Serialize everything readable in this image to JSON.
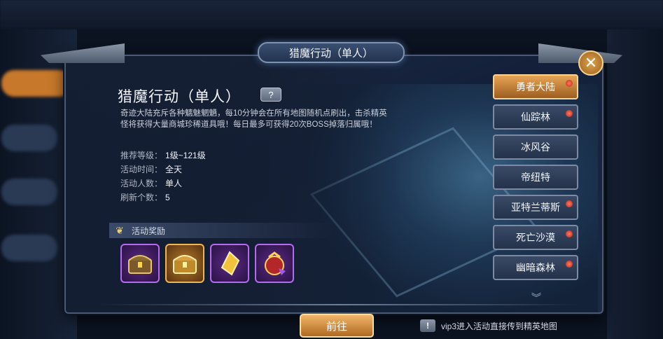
{
  "panel": {
    "header": "猎魔行动（单人）",
    "title": "猎魔行动（单人）",
    "help_glyph": "?",
    "close_glyph": "✕",
    "description_line1": "奇迹大陆充斥各种魑魅魍魉，每10分钟会在所有地图随机点刷出，击杀精英",
    "description_line2": "怪将获得大量商城珍稀道具哦！每日最多可获得20次BOSS掉落归属哦！"
  },
  "info": [
    {
      "label": "推荐等级：",
      "value": "1级~121级"
    },
    {
      "label": "活动时间：",
      "value": "全天"
    },
    {
      "label": "活动人数：",
      "value": "单人"
    },
    {
      "label": "刷新个数：",
      "value": "5"
    }
  ],
  "rewards": {
    "header": "活动奖励",
    "items": [
      {
        "icon": "treasure-chest-icon",
        "rarity": "purple"
      },
      {
        "icon": "treasure-chest-icon",
        "rarity": "gold"
      },
      {
        "icon": "gold-crystal-icon",
        "rarity": "purple"
      },
      {
        "icon": "gift-bag-icon",
        "rarity": "purple"
      }
    ]
  },
  "maps": [
    {
      "label": "勇者大陆",
      "active": true,
      "dot": true
    },
    {
      "label": "仙踪林",
      "active": false,
      "dot": true
    },
    {
      "label": "冰风谷",
      "active": false,
      "dot": false
    },
    {
      "label": "帝纽特",
      "active": false,
      "dot": false
    },
    {
      "label": "亚特兰蒂斯",
      "active": false,
      "dot": true
    },
    {
      "label": "死亡沙漠",
      "active": false,
      "dot": true
    },
    {
      "label": "幽暗森林",
      "active": false,
      "dot": true
    }
  ],
  "footer": {
    "go_label": "前往",
    "tip_icon": "!",
    "tip_text": "vip3进入活动直接传到精英地图"
  },
  "colors": {
    "accent_gold": "#e6a555",
    "dot_red": "#c0221a",
    "reward_purple": "#b46bf0"
  }
}
